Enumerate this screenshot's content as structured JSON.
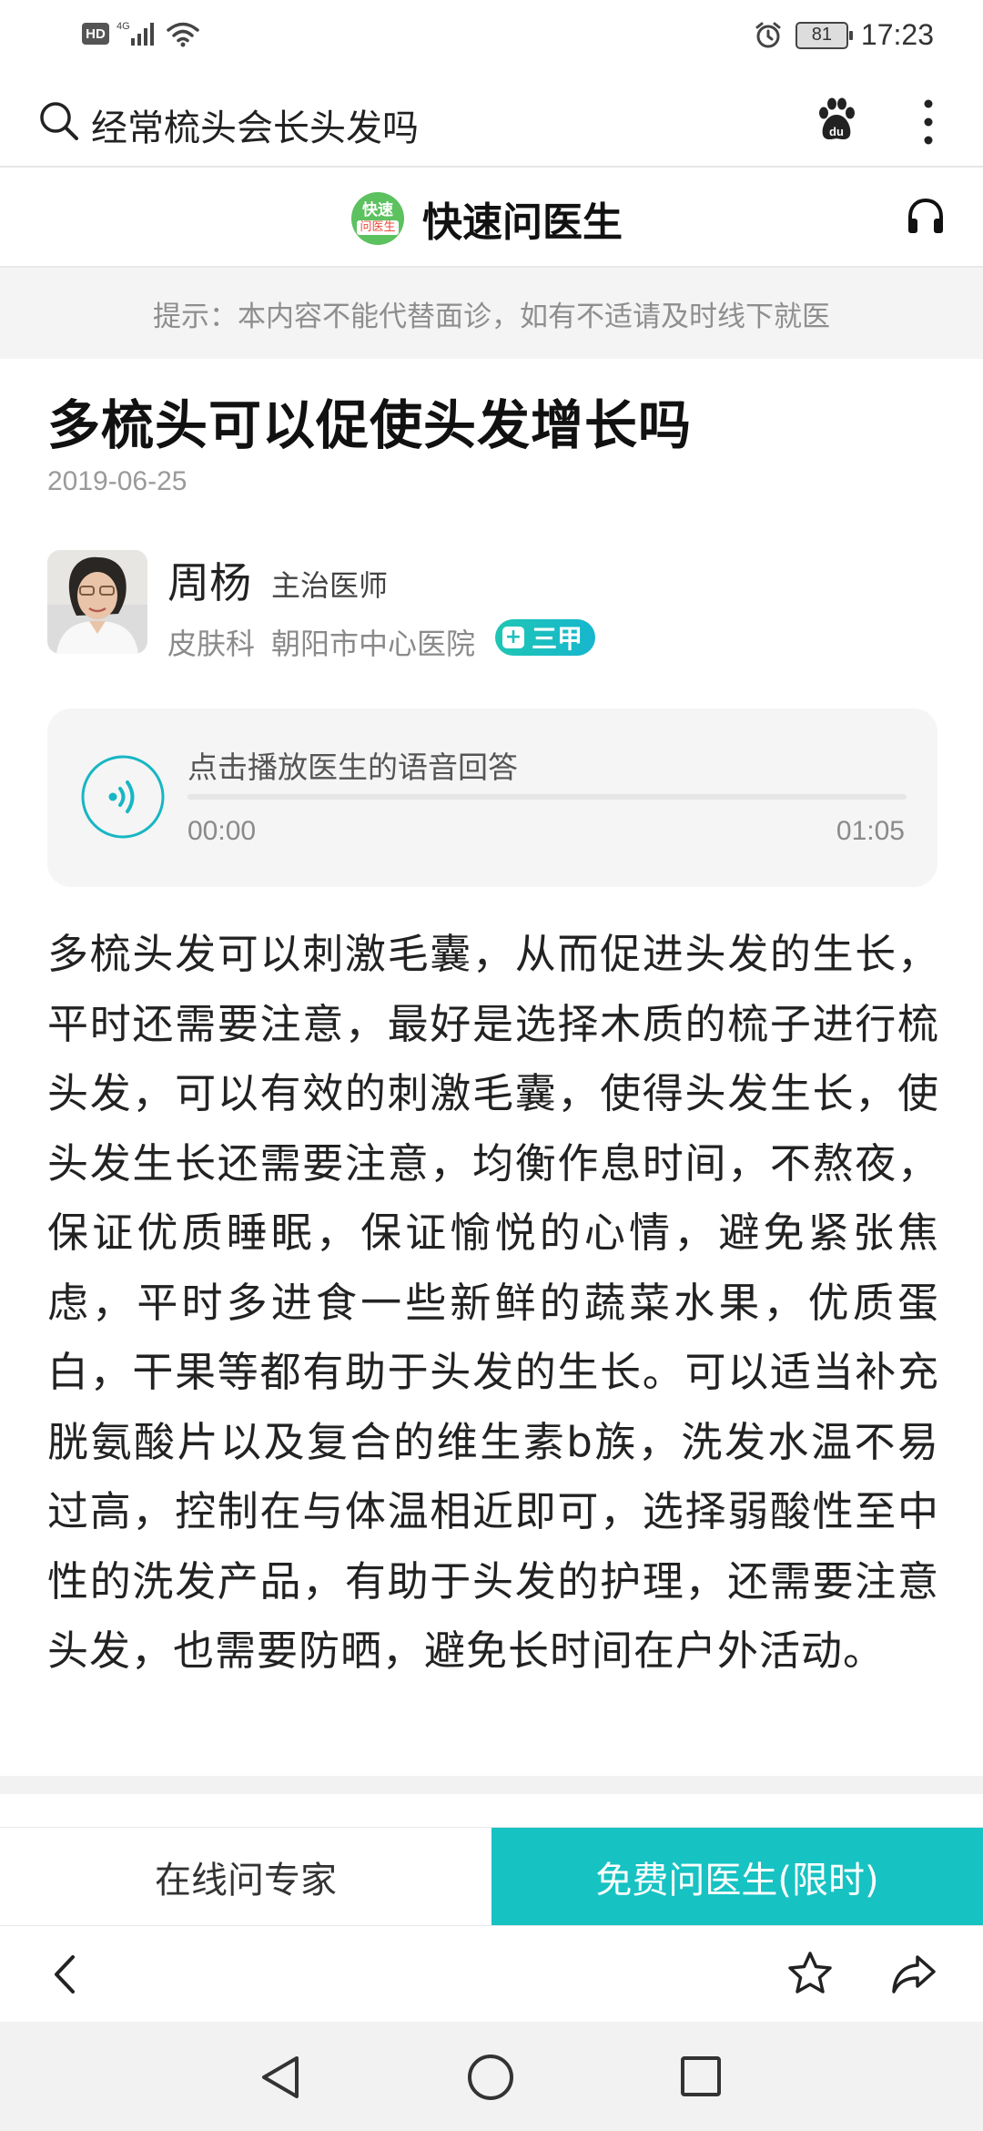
{
  "status_bar": {
    "hd": "HD",
    "network": "4G",
    "battery": "81",
    "time": "17:23"
  },
  "search": {
    "query": "经常梳头会长头发吗"
  },
  "site": {
    "logo_line1": "快速",
    "logo_line2": "问医生",
    "name": "快速问医生"
  },
  "tip": "提示：本内容不能代替面诊，如有不适请及时线下就医",
  "article": {
    "title": "多梳头可以促使头发增长吗",
    "date": "2019-06-25",
    "body": "多梳头发可以刺激毛囊，从而促进头发的生长，平时还需要注意，最好是选择木质的梳子进行梳头发，可以有效的刺激毛囊，使得头发生长，使头发生长还需要注意，均衡作息时间，不熬夜，保证优质睡眠，保证愉悦的心情，避免紧张焦虑，平时多进食一些新鲜的蔬菜水果，优质蛋白，干果等都有助于头发的生长。可以适当补充胱氨酸片以及复合的维生素b族，洗发水温不易过高，控制在与体温相近即可，选择弱酸性至中性的洗发产品，有助于头发的护理，还需要注意头发，也需要防晒，避免长时间在户外活动。"
  },
  "doctor": {
    "name": "周杨",
    "title": "主治医师",
    "department": "皮肤科",
    "hospital": "朝阳市中心医院",
    "grade_plus": "+",
    "grade": "三甲"
  },
  "audio": {
    "label": "点击播放医生的语音回答",
    "current": "00:00",
    "duration": "01:05",
    "progress": 0
  },
  "cta": {
    "left": "在线问专家",
    "right": "免费问医生(限时)"
  },
  "colors": {
    "accent": "#17c2c2",
    "logo_green": "#5cc15f",
    "tip_text": "#8e8e8e"
  },
  "icons": [
    "search-icon",
    "baidu-paw-icon",
    "more-vertical-icon",
    "headphone-icon",
    "voice-play-icon",
    "back-arrow-icon",
    "star-icon",
    "share-icon",
    "nav-back-icon",
    "nav-home-icon",
    "nav-recent-icon"
  ]
}
